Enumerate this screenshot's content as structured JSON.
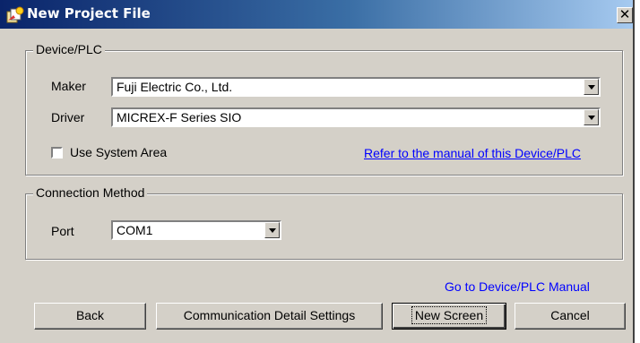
{
  "window": {
    "title": "New Project File",
    "close_glyph": "✕"
  },
  "device_group": {
    "label": "Device/PLC",
    "maker_label": "Maker",
    "maker_value": "Fuji Electric Co., Ltd.",
    "driver_label": "Driver",
    "driver_value": "MICREX-F Series SIO",
    "use_system_area_label": "Use System Area",
    "use_system_area_checked": false,
    "manual_link": "Refer to the manual of this Device/PLC"
  },
  "connection_group": {
    "label": "Connection Method",
    "port_label": "Port",
    "port_value": "COM1"
  },
  "footer": {
    "manual_link": "Go to Device/PLC Manual",
    "back_label": "Back",
    "comm_settings_label": "Communication Detail Settings",
    "new_screen_label": "New Screen",
    "cancel_label": "Cancel"
  },
  "colors": {
    "title_gradient_start": "#0a246a",
    "title_gradient_end": "#a6caf0",
    "face": "#d4d0c8",
    "link": "#0000ff"
  },
  "icons": {
    "title": "new-project-icon",
    "combo_arrow": "chevron-down-icon"
  }
}
